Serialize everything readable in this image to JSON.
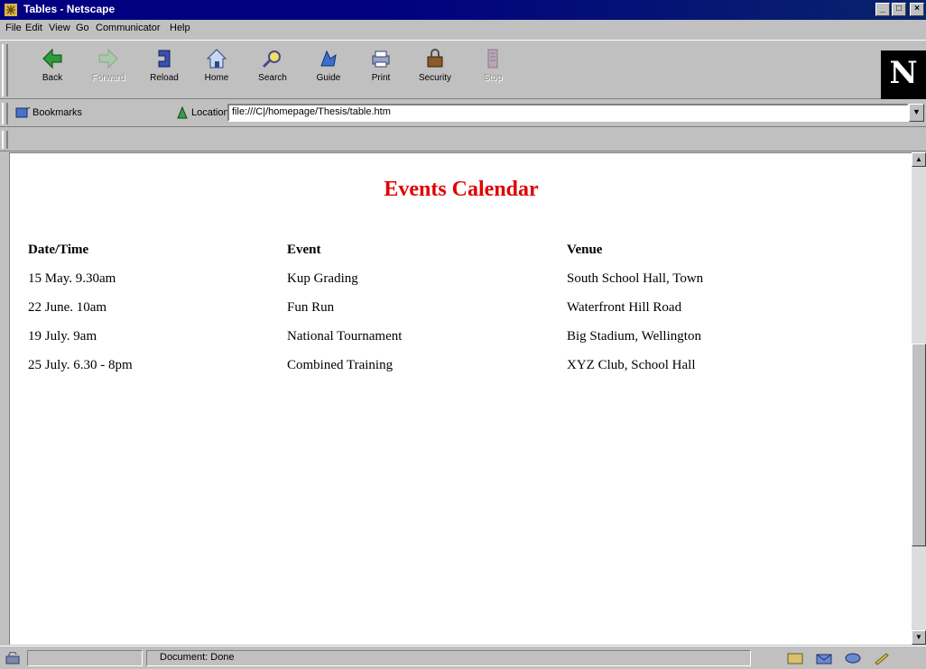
{
  "window": {
    "title": "Tables - Netscape",
    "min": "_",
    "max": "□",
    "close": "×"
  },
  "menu": [
    "File",
    "Edit",
    "View",
    "Go",
    "Communicator",
    "Help"
  ],
  "toolbar": [
    {
      "label": "Back",
      "icon": "back-icon",
      "enabled": true
    },
    {
      "label": "Forward",
      "icon": "forward-icon",
      "enabled": false
    },
    {
      "label": "Reload",
      "icon": "reload-icon",
      "enabled": true
    },
    {
      "label": "Home",
      "icon": "home-icon",
      "enabled": true
    },
    {
      "label": "Search",
      "icon": "search-icon",
      "enabled": true
    },
    {
      "label": "Guide",
      "icon": "guide-icon",
      "enabled": true
    },
    {
      "label": "Print",
      "icon": "print-icon",
      "enabled": true
    },
    {
      "label": "Security",
      "icon": "security-icon",
      "enabled": true
    },
    {
      "label": "Stop",
      "icon": "stop-icon",
      "enabled": false
    }
  ],
  "logo": "N",
  "location": {
    "bookmarks_label": "Bookmarks",
    "location_label": "Location:",
    "url": "file:///C|/homepage/Thesis/table.htm"
  },
  "page": {
    "heading": "Events Calendar",
    "heading_color": "#e00000",
    "columns": [
      "Date/Time",
      "Event",
      "Venue"
    ],
    "rows": [
      [
        "15 May. 9.30am",
        "Kup Grading",
        "South School Hall, Town"
      ],
      [
        "22 June. 10am",
        "Fun Run",
        "Waterfront Hill Road"
      ],
      [
        "19 July. 9am",
        "National Tournament",
        "Big Stadium, Wellington"
      ],
      [
        "25 July. 6.30 - 8pm",
        "Combined Training",
        "XYZ Club, School Hall"
      ]
    ]
  },
  "status": {
    "message": "Document: Done"
  }
}
